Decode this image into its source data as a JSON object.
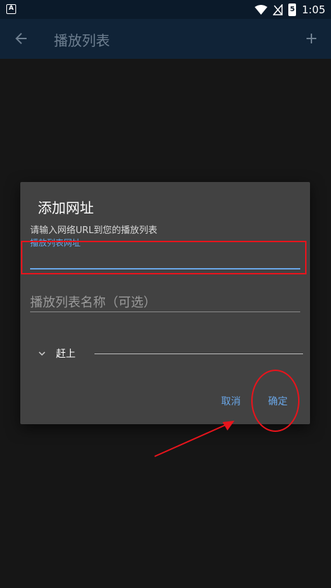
{
  "status_bar": {
    "left_icon": "A",
    "battery_level": "5",
    "time": "1:05",
    "icons": [
      "wifi-icon",
      "no-signal-icon",
      "battery-icon"
    ]
  },
  "app_bar": {
    "title": "播放列表",
    "back_icon": "arrow-left-icon",
    "add_icon": "plus-icon"
  },
  "dialog": {
    "title": "添加网址",
    "description": "请输入网络URL到您的播放列表",
    "url_field": {
      "label": "播放列表网址",
      "value": ""
    },
    "name_field": {
      "placeholder": "播放列表名称（可选）",
      "value": ""
    },
    "advanced_label": "赶上",
    "cancel_label": "取消",
    "ok_label": "确定"
  },
  "colors": {
    "accent": "#6aa6e6",
    "annotation": "#e8141c",
    "dialog_bg": "#424242",
    "app_bar_bg": "#102337"
  }
}
